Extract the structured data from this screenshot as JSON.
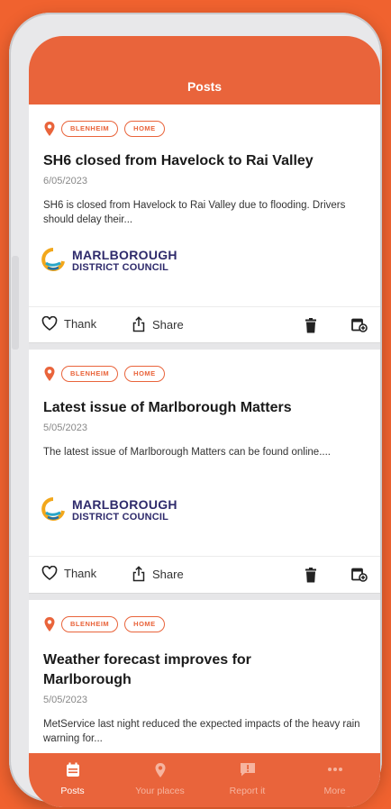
{
  "header": {
    "title": "Posts"
  },
  "posts": [
    {
      "tags": [
        "BLENHEIM",
        "HOME"
      ],
      "title": "SH6 closed from Havelock to Rai Valley",
      "date": "6/05/2023",
      "excerpt": "SH6 is closed from Havelock to Rai Valley due to flooding. Drivers should delay their...",
      "org_line1": "MARLBOROUGH",
      "org_line2": "DISTRICT COUNCIL"
    },
    {
      "tags": [
        "BLENHEIM",
        "HOME"
      ],
      "title": "Latest issue of Marlborough Matters",
      "date": "5/05/2023",
      "excerpt": "The latest issue of Marlborough Matters can be found online....",
      "org_line1": "MARLBOROUGH",
      "org_line2": "DISTRICT COUNCIL"
    },
    {
      "tags": [
        "BLENHEIM",
        "HOME"
      ],
      "title": "Weather forecast improves for Marlborough",
      "date": "5/05/2023",
      "excerpt": "MetService last night reduced the expected impacts of the heavy rain warning for..."
    }
  ],
  "actions": {
    "thank": "Thank",
    "share": "Share"
  },
  "tabs": [
    {
      "label": "Posts",
      "icon": "calendar-icon"
    },
    {
      "label": "Your places",
      "icon": "location-pin-icon"
    },
    {
      "label": "Report it",
      "icon": "report-icon"
    },
    {
      "label": "More",
      "icon": "more-dots-icon"
    }
  ],
  "colors": {
    "accent": "#e9643b",
    "background": "#f0622f",
    "logo_text": "#2e2a6b"
  }
}
